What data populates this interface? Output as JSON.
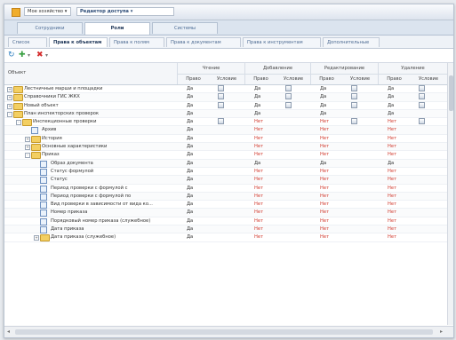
{
  "toolbar": {
    "app_select": "Мое хозяйство",
    "object_select": "Редактор доступа"
  },
  "top_tabs": [
    "Сотрудники",
    "Роли",
    "Системы"
  ],
  "sub_tabs": [
    "Список",
    "Права к объектам",
    "Права к полям",
    "Права к документам",
    "Права к инструментам",
    "Дополнительные"
  ],
  "columns": {
    "object": "Объект",
    "groups": [
      "Чтение",
      "Добавление",
      "Редактирование",
      "Удаление"
    ],
    "sub": [
      "Право",
      "Условие"
    ]
  },
  "rows": [
    {
      "level": 0,
      "type": "folder",
      "toggle": "+",
      "name": "Лестничные марши и площадки",
      "v": [
        "Да",
        "chk",
        "Да",
        "chk",
        "Да",
        "chk",
        "Да",
        "chk"
      ]
    },
    {
      "level": 0,
      "type": "folder",
      "toggle": "+",
      "name": "Справочники ГИС ЖКХ",
      "v": [
        "Да",
        "chk",
        "Да",
        "chk",
        "Да",
        "chk",
        "Да",
        "chk"
      ]
    },
    {
      "level": 0,
      "type": "folder",
      "toggle": "+",
      "name": "Новый объект",
      "v": [
        "Да",
        "chk",
        "Да",
        "chk",
        "Да",
        "chk",
        "Да",
        "chk"
      ]
    },
    {
      "level": 0,
      "type": "folder",
      "toggle": "-",
      "name": "План инспекторских проверок",
      "v": [
        "Да",
        "",
        "Да",
        "",
        "Да",
        "",
        "Да",
        ""
      ]
    },
    {
      "level": 1,
      "type": "folder",
      "toggle": "-",
      "name": "Инспекционные проверки",
      "v": [
        "Да",
        "chk",
        "Нет",
        "",
        "Нет",
        "chk",
        "Нет",
        "chk"
      ]
    },
    {
      "level": 2,
      "type": "doc",
      "toggle": "",
      "name": "Архив",
      "v": [
        "Да",
        "",
        "Нет",
        "",
        "Нет",
        "",
        "Нет",
        ""
      ]
    },
    {
      "level": 2,
      "type": "folder",
      "toggle": "+",
      "name": "История",
      "v": [
        "Да",
        "",
        "Нет",
        "",
        "Нет",
        "",
        "Нет",
        ""
      ]
    },
    {
      "level": 2,
      "type": "folder",
      "toggle": "+",
      "name": "Основные характеристики",
      "v": [
        "Да",
        "",
        "Нет",
        "",
        "Нет",
        "",
        "Нет",
        ""
      ]
    },
    {
      "level": 2,
      "type": "folder",
      "toggle": "-",
      "name": "Приказ",
      "v": [
        "Да",
        "",
        "Нет",
        "",
        "Нет",
        "",
        "Нет",
        ""
      ]
    },
    {
      "level": 3,
      "type": "doc",
      "toggle": "",
      "name": "Образ документа",
      "v": [
        "Да",
        "",
        "Да",
        "",
        "Да",
        "",
        "Да",
        ""
      ]
    },
    {
      "level": 3,
      "type": "doc",
      "toggle": "",
      "name": "Статус формулой",
      "v": [
        "Да",
        "",
        "Нет",
        "",
        "Нет",
        "",
        "Нет",
        ""
      ]
    },
    {
      "level": 3,
      "type": "doc",
      "toggle": "",
      "name": "Статус",
      "v": [
        "Да",
        "",
        "Нет",
        "",
        "Нет",
        "",
        "Нет",
        ""
      ]
    },
    {
      "level": 3,
      "type": "doc",
      "toggle": "",
      "name": "Период проверки с формулой с",
      "v": [
        "Да",
        "",
        "Нет",
        "",
        "Нет",
        "",
        "Нет",
        ""
      ]
    },
    {
      "level": 3,
      "type": "doc",
      "toggle": "",
      "name": "Период проверки с формулой по",
      "v": [
        "Да",
        "",
        "Нет",
        "",
        "Нет",
        "",
        "Нет",
        ""
      ]
    },
    {
      "level": 3,
      "type": "doc",
      "toggle": "",
      "name": "Вид проверки в зависимости от вида ко...",
      "v": [
        "Да",
        "",
        "Нет",
        "",
        "Нет",
        "",
        "Нет",
        ""
      ]
    },
    {
      "level": 3,
      "type": "doc",
      "toggle": "",
      "name": "Номер приказа",
      "v": [
        "Да",
        "",
        "Нет",
        "",
        "Нет",
        "",
        "Нет",
        ""
      ]
    },
    {
      "level": 3,
      "type": "doc",
      "toggle": "",
      "name": "Порядковый номер приказа (служебное)",
      "v": [
        "Да",
        "",
        "Нет",
        "",
        "Нет",
        "",
        "Нет",
        ""
      ]
    },
    {
      "level": 3,
      "type": "doc",
      "toggle": "",
      "name": "Дата приказа",
      "v": [
        "Да",
        "",
        "Нет",
        "",
        "Нет",
        "",
        "Нет",
        ""
      ]
    },
    {
      "level": 3,
      "type": "folder",
      "toggle": "+",
      "name": "Дата приказа (служебное)",
      "v": [
        "Да",
        "",
        "Нет",
        "",
        "Нет",
        "",
        "Нет",
        ""
      ]
    }
  ]
}
